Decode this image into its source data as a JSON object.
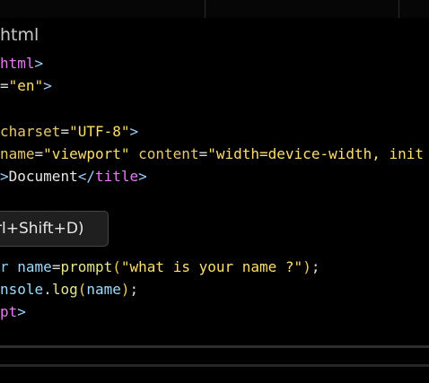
{
  "breadcrumb": {
    "text": "html"
  },
  "code": {
    "l1_tag": "html",
    "l1_close": ">",
    "l2_attr_eq": "=",
    "l2_val": "\"en\"",
    "l2_close": ">",
    "l4_attr": "charset",
    "l4_eq": "=",
    "l4_val": "\"UTF-8\"",
    "l4_close": ">",
    "l5_attr1": "name",
    "l5_eq1": "=",
    "l5_val1": "\"viewport\"",
    "l5_attr2": "content",
    "l5_eq2": "=",
    "l5_val2": "\"width=device-width, init",
    "l6_close1": ">",
    "l6_text": "Document",
    "l6_open": "</",
    "l6_tag": "title",
    "l6_close2": ">",
    "l8_kw": "r",
    "l8_var": "name",
    "l8_eq": "=",
    "l8_func": "prompt",
    "l8_paren_open": "(",
    "l8_str": "\"what is your name ?\"",
    "l8_paren_close": ")",
    "l8_semi": ";",
    "l9_obj": "nsole",
    "l9_dot": ".",
    "l9_method": "log",
    "l9_paren_open": "(",
    "l9_arg": "name",
    "l9_paren_close": ")",
    "l9_semi": ";",
    "l10_tag": "pt",
    "l10_close": ">"
  },
  "tooltip": {
    "text": "rl+Shift+D)"
  }
}
